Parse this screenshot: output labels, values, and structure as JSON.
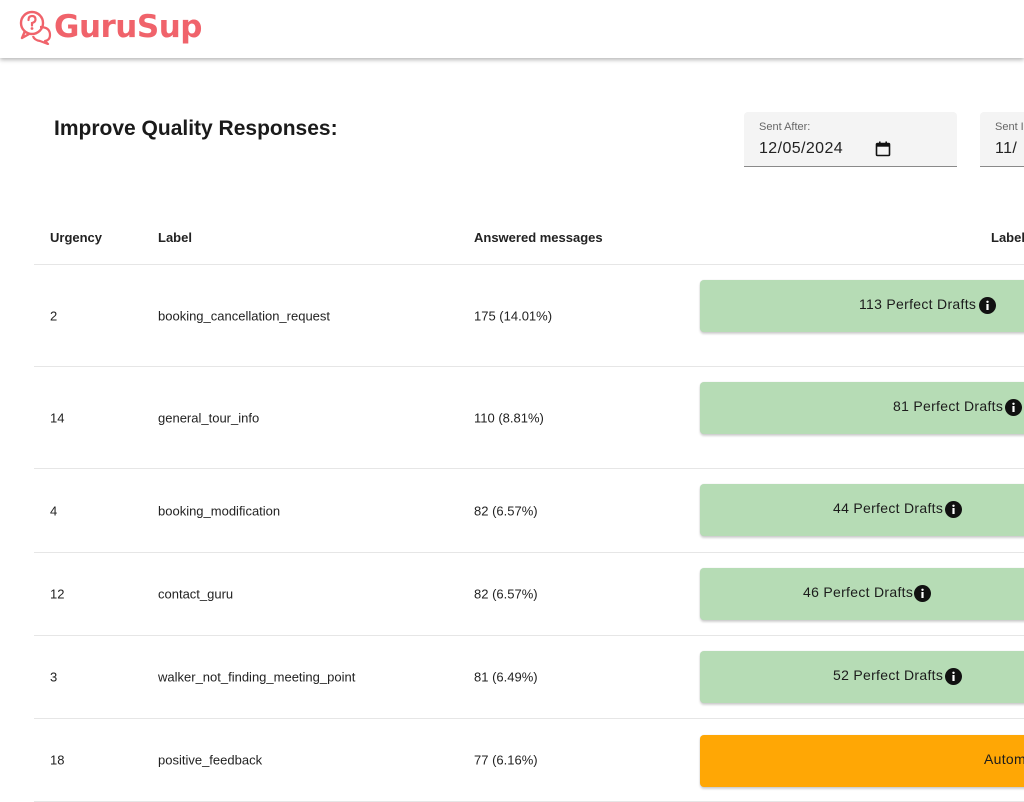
{
  "brand": {
    "name": "GuruSup",
    "color": "#f0636b"
  },
  "page": {
    "title": "Improve Quality Responses:"
  },
  "filters": {
    "sent_after": {
      "label": "Sent After:",
      "value": "12/05/2024"
    },
    "sent_before": {
      "label": "Sent I",
      "value": "11/"
    }
  },
  "table": {
    "headers": {
      "urgency": "Urgency",
      "label": "Label",
      "answered": "Answered messages",
      "label_action": "Label"
    },
    "rows": [
      {
        "urgency": "2",
        "label": "booking_cancellation_request",
        "answered": "175 (14.01%)",
        "action": "113 Perfect Drafts",
        "status": "green"
      },
      {
        "urgency": "14",
        "label": "general_tour_info",
        "answered": "110 (8.81%)",
        "action": "81 Perfect Drafts",
        "status": "green"
      },
      {
        "urgency": "4",
        "label": "booking_modification",
        "answered": "82 (6.57%)",
        "action": "44 Perfect Drafts",
        "status": "green"
      },
      {
        "urgency": "12",
        "label": "contact_guru",
        "answered": "82 (6.57%)",
        "action": "46 Perfect Drafts",
        "status": "green"
      },
      {
        "urgency": "3",
        "label": "walker_not_finding_meeting_point",
        "answered": "81 (6.49%)",
        "action": "52 Perfect Drafts",
        "status": "green"
      },
      {
        "urgency": "18",
        "label": "positive_feedback",
        "answered": "77 (6.16%)",
        "action": "Autom",
        "status": "orange"
      }
    ]
  },
  "colors": {
    "green": "#b6dcb5",
    "orange": "#ffa705"
  },
  "icons": {
    "logo": "chat-question-icon",
    "calendar": "calendar-icon",
    "info": "info-icon"
  }
}
